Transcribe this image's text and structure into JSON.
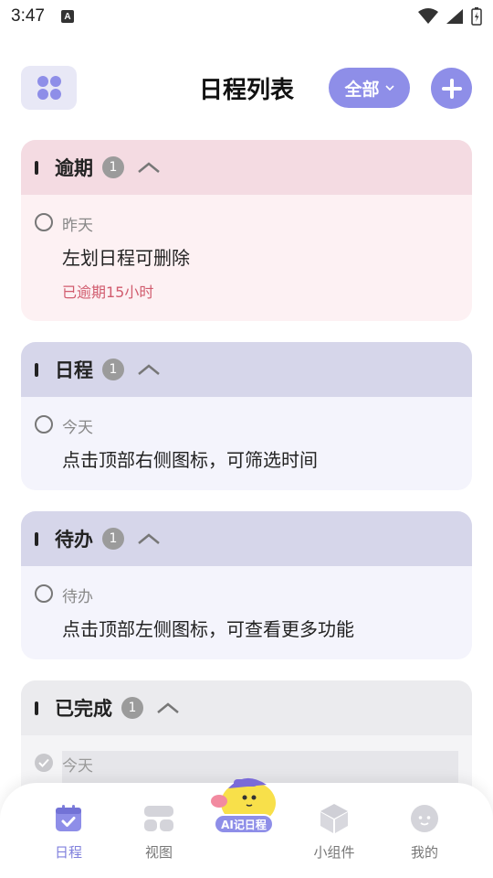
{
  "status_bar": {
    "time": "3:47",
    "notification_badge": "A"
  },
  "header": {
    "title": "日程列表",
    "filter_label": "全部"
  },
  "sections": [
    {
      "label": "逾期",
      "count": "1",
      "items": [
        {
          "date": "昨天",
          "title": "左划日程可删除",
          "overdue": "已逾期15小时"
        }
      ]
    },
    {
      "label": "日程",
      "count": "1",
      "items": [
        {
          "date": "今天",
          "title": "点击顶部右侧图标，可筛选时间"
        }
      ]
    },
    {
      "label": "待办",
      "count": "1",
      "items": [
        {
          "date": "待办",
          "title": "点击顶部左侧图标，可查看更多功能"
        }
      ]
    },
    {
      "label": "已完成",
      "count": "1",
      "items": [
        {
          "date": "今天"
        }
      ]
    }
  ],
  "tabbar": {
    "tabs": [
      {
        "label": "日程",
        "icon": "calendar-icon",
        "active": true
      },
      {
        "label": "视图",
        "icon": "grid-view-icon",
        "active": false
      },
      {
        "label": "AI记日程",
        "icon": "ai-mascot-icon",
        "active": false
      },
      {
        "label": "小组件",
        "icon": "cube-icon",
        "active": false
      },
      {
        "label": "我的",
        "icon": "profile-icon",
        "active": false
      }
    ]
  },
  "colors": {
    "accent": "#8e8ee8",
    "overdue_header": "#f4dbe2",
    "schedule_header": "#d6d6ea",
    "done_header": "#ebebee",
    "overdue_text": "#d15c6e"
  }
}
